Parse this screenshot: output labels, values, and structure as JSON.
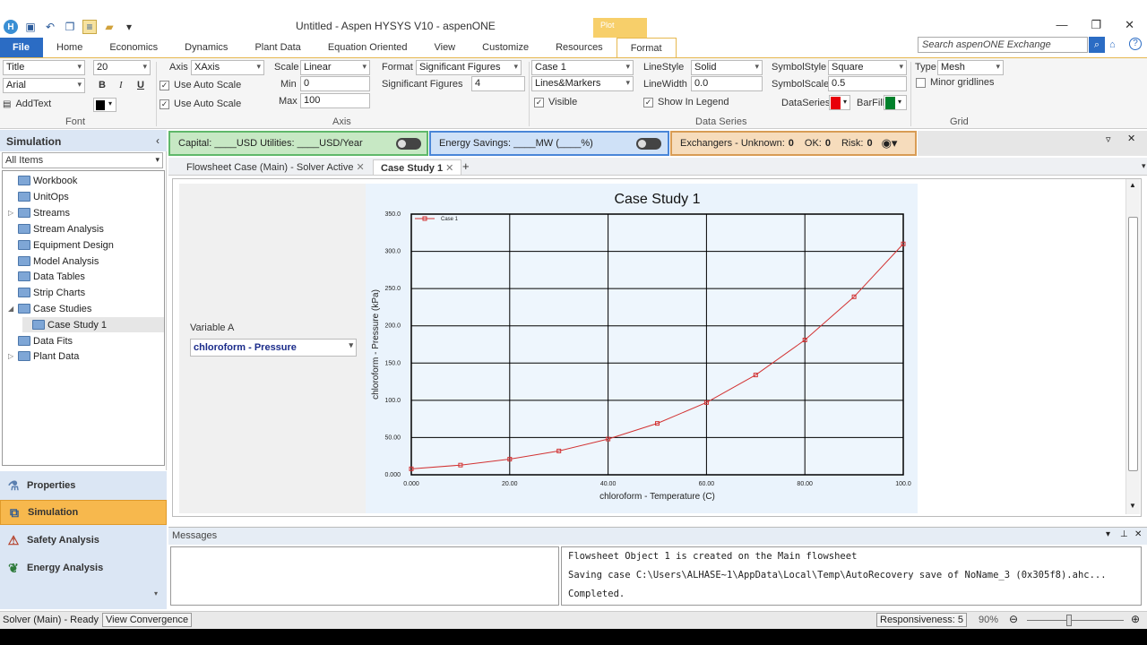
{
  "window": {
    "title": "Untitled - Aspen HYSYS V10 - aspenONE",
    "context_tab": "Plot"
  },
  "ribbon_tabs": [
    "File",
    "Home",
    "Economics",
    "Dynamics",
    "Plant Data",
    "Equation Oriented",
    "View",
    "Customize",
    "Resources",
    "Format"
  ],
  "search": {
    "placeholder": "Search aspenONE Exchange"
  },
  "font_group": {
    "label": "Font",
    "element": "Title",
    "size": "20",
    "family": "Arial",
    "bold": "B",
    "italic": "I",
    "underline": "U",
    "add_text": "AddText"
  },
  "axis_group": {
    "label": "Axis",
    "axis_label": "Axis",
    "axis": "XAxis",
    "use_auto_scale_1": "Use Auto Scale",
    "use_auto_scale_2": "Use Auto Scale",
    "scale_label": "Scale",
    "scale": "Linear",
    "min_label": "Min",
    "min": "0",
    "max_label": "Max",
    "max": "100",
    "format_label": "Format",
    "format": "Significant Figures",
    "sigfig_label": "Significant Figures",
    "sigfig": "4"
  },
  "series_group": {
    "label": "Data Series",
    "case": "Case 1",
    "mode": "Lines&Markers",
    "visible": "Visible",
    "linestyle_label": "LineStyle",
    "linestyle": "Solid",
    "linewidth_label": "LineWidth",
    "linewidth": "0.0",
    "show_legend": "Show In Legend",
    "symbolstyle_label": "SymbolStyle",
    "symbolstyle": "Square",
    "symbolscale_label": "SymbolScale",
    "symbolscale": "0.5",
    "dataseries_label": "DataSeries",
    "barfill_label": "BarFill",
    "dataseries_color": "#e8000a",
    "barfill_color": "#00802b"
  },
  "grid_group": {
    "label": "Grid",
    "type_label": "Type",
    "type": "Mesh",
    "minor": "Minor gridlines"
  },
  "nav": {
    "header": "Simulation",
    "filter": "All Items",
    "tree": [
      "Workbook",
      "UnitOps",
      "Streams",
      "Stream Analysis",
      "Equipment Design",
      "Model Analysis",
      "Data Tables",
      "Strip Charts",
      "Case Studies",
      "Case Study 1",
      "Data Fits",
      "Plant Data"
    ],
    "buttons": [
      "Properties",
      "Simulation",
      "Safety Analysis",
      "Energy Analysis"
    ]
  },
  "panels": {
    "capital": "Capital: ____USD   Utilities: ____USD/Year",
    "energy": "Energy Savings: ____MW   (____%)",
    "exchangers": "Exchangers -  Unknown:",
    "unknown": "0",
    "ok_label": "OK:",
    "ok": "0",
    "risk_label": "Risk:",
    "risk": "0"
  },
  "doc_tabs": [
    "Flowsheet Case (Main) - Solver Active",
    "Case Study 1"
  ],
  "variable": {
    "label": "Variable A",
    "value": "chloroform - Pressure"
  },
  "chart_data": {
    "type": "line",
    "title": "Case Study 1",
    "xlabel": "chloroform - Temperature (C)",
    "ylabel": "chloroform - Pressure (kPa)",
    "xlim": [
      0,
      100
    ],
    "ylim": [
      0,
      350
    ],
    "xticks": [
      "0.000",
      "20.00",
      "40.00",
      "60.00",
      "80.00",
      "100.0"
    ],
    "yticks": [
      "0.000",
      "50.00",
      "100.0",
      "150.0",
      "200.0",
      "250.0",
      "300.0",
      "350.0"
    ],
    "grid": true,
    "legend": "top-left",
    "series": [
      {
        "name": "Case 1",
        "color": "#d23232",
        "x": [
          0,
          10,
          20,
          30,
          40,
          50,
          60,
          70,
          80,
          90,
          100
        ],
        "y": [
          8,
          13,
          21,
          32,
          48,
          69,
          97,
          134,
          181,
          239,
          310
        ]
      }
    ]
  },
  "messages": {
    "title": "Messages",
    "lines": [
      "Flowsheet Object 1 is created on the Main flowsheet",
      "Saving case C:\\Users\\ALHASE~1\\AppData\\Local\\Temp\\AutoRecovery save of NoName_3 (0x305f8).ahc...",
      "Completed."
    ]
  },
  "status": {
    "solver": "Solver (Main) - Ready",
    "view_convergence": "View Convergence",
    "responsiveness": "Responsiveness: 5",
    "zoom": "90%"
  }
}
